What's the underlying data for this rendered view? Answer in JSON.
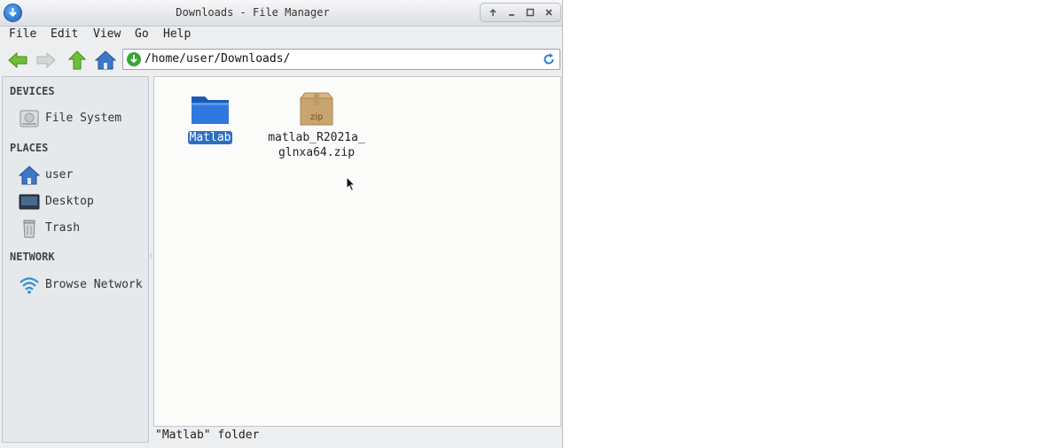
{
  "window": {
    "title": "Downloads - File Manager"
  },
  "menu": [
    "File",
    "Edit",
    "View",
    "Go",
    "Help"
  ],
  "address_bar": {
    "path": "/home/user/Downloads/"
  },
  "sidebar": {
    "sections": [
      {
        "heading": "DEVICES",
        "items": [
          {
            "label": "File System",
            "icon": "drive-icon"
          }
        ]
      },
      {
        "heading": "PLACES",
        "items": [
          {
            "label": "user",
            "icon": "home-icon"
          },
          {
            "label": "Desktop",
            "icon": "desktop-icon"
          },
          {
            "label": "Trash",
            "icon": "trash-icon"
          }
        ]
      },
      {
        "heading": "NETWORK",
        "items": [
          {
            "label": "Browse Network",
            "icon": "wifi-icon"
          }
        ]
      }
    ]
  },
  "files": [
    {
      "name": "Matlab",
      "type": "folder",
      "selected": true
    },
    {
      "name_line1": "matlab_R2021a_",
      "name_line2": "glnxa64.zip",
      "type": "zip",
      "badge": "zip",
      "selected": false
    }
  ],
  "status": {
    "text": "\"Matlab\" folder"
  },
  "colors": {
    "selection": "#2f6fc1",
    "folder": "#1f6fd0"
  }
}
